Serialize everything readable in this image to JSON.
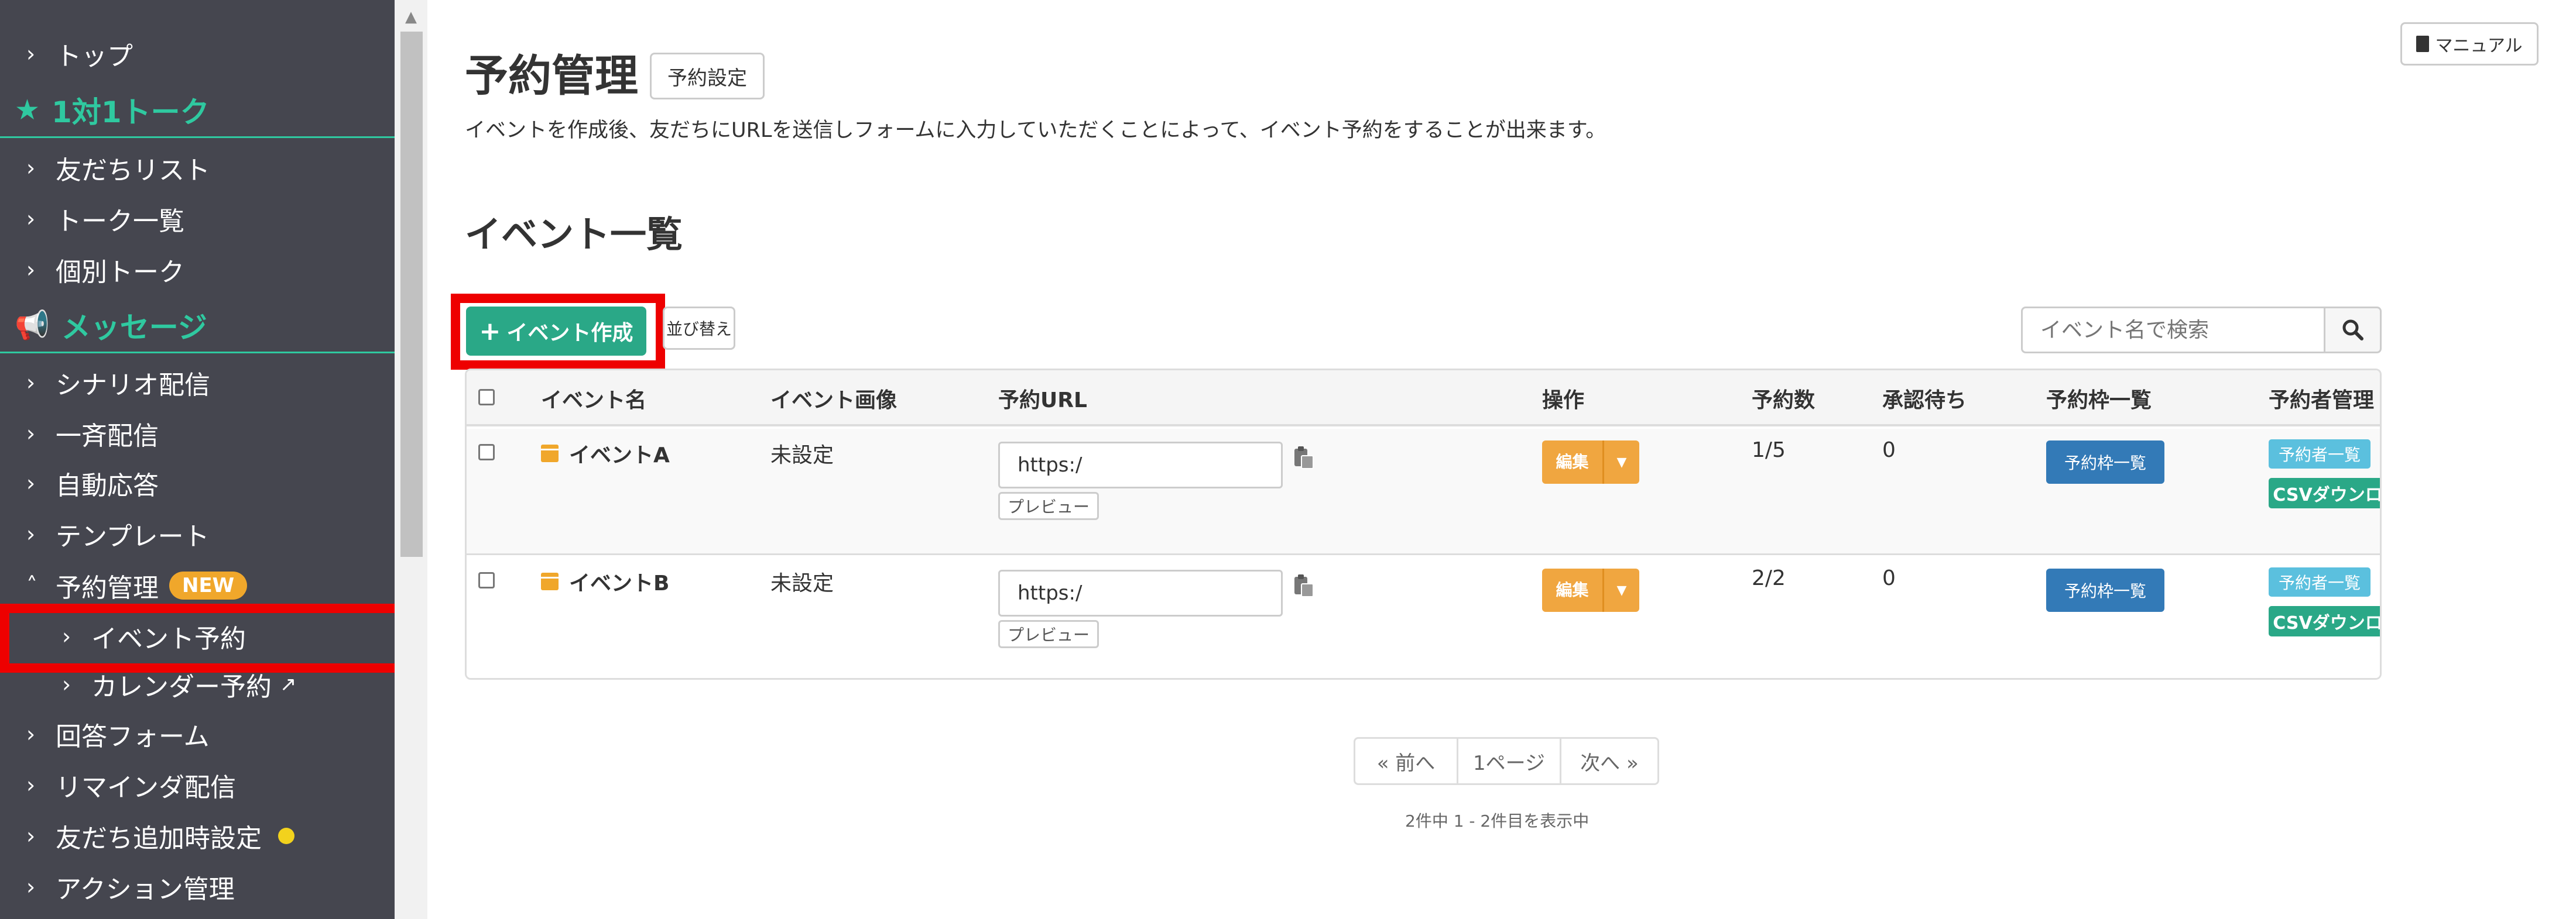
{
  "sidebar": {
    "top": "トップ",
    "section_talk": "1対1トーク",
    "friends_list": "友だちリスト",
    "talk_list": "トーク一覧",
    "individual_talk": "個別トーク",
    "section_message": "メッセージ",
    "scenario": "シナリオ配信",
    "broadcast": "一斉配信",
    "auto_reply": "自動応答",
    "template": "テンプレート",
    "reservation": "予約管理",
    "new_badge": "NEW",
    "event_reservation": "イベント予約",
    "calendar_reservation": "カレンダー予約",
    "answer_form": "回答フォーム",
    "reminder": "リマインダ配信",
    "friend_add_settings": "友だち追加時設定",
    "action_mgmt": "アクション管理"
  },
  "header": {
    "title": "予約管理",
    "settings_button": "予約設定",
    "manual_button": "マニュアル",
    "description": "イベントを作成後、友だちにURLを送信しフォームに入力していただくことによって、イベント予約をすることが出来ます。"
  },
  "events": {
    "section_title": "イベント一覧",
    "create_button": "イベント作成",
    "sort_button": "並び替え",
    "search_placeholder": "イベント名で検索",
    "columns": {
      "name": "イベント名",
      "image": "イベント画像",
      "url": "予約URL",
      "ops": "操作",
      "count": "予約数",
      "pending": "承認待ち",
      "slots": "予約枠一覧",
      "manage": "予約者管理"
    },
    "rows": [
      {
        "name": "イベントA",
        "image": "未設定",
        "url": "https:/",
        "preview": "プレビュー",
        "edit": "編集",
        "count": "1/5",
        "pending": "0",
        "slots_button": "予約枠一覧",
        "reservers_button": "予約者一覧",
        "csv_button": "CSVダウンロード"
      },
      {
        "name": "イベントB",
        "image": "未設定",
        "url": "https:/",
        "preview": "プレビュー",
        "edit": "編集",
        "count": "2/2",
        "pending": "0",
        "slots_button": "予約枠一覧",
        "reservers_button": "予約者一覧",
        "csv_button": "CSVダウンロード"
      }
    ]
  },
  "pagination": {
    "prev": "« 前へ",
    "current": "1ページ",
    "next": "次へ »",
    "info": "2件中 1 - 2件目を表示中"
  },
  "colors": {
    "sidebar_bg": "#45464f",
    "accent_green": "#2aa887",
    "section_green": "#2fc9a0",
    "highlight_red": "#ee0000",
    "edit_orange": "#f0a640",
    "primary_blue": "#337ab7",
    "info_blue": "#5bc0de"
  }
}
